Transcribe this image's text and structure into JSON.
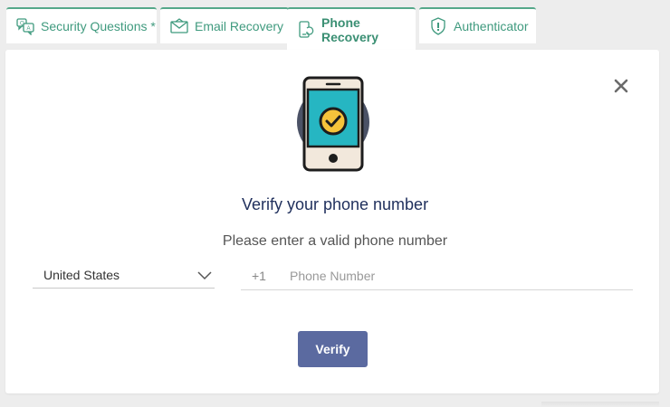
{
  "tabs": [
    {
      "label": "Security Questions *",
      "icon": "qa-chat-icon"
    },
    {
      "label": "Email Recovery",
      "icon": "envelope-icon"
    },
    {
      "label": "Phone Recovery",
      "icon": "phone-sync-icon",
      "active": true
    },
    {
      "label": "Authenticator",
      "icon": "shield-check-icon"
    }
  ],
  "dialog": {
    "title": "Verify your phone number",
    "subtitle": "Please enter a valid phone number",
    "close_icon": "close-icon",
    "illustration": "phone-check-icon"
  },
  "form": {
    "country": "United States",
    "dial_code": "+1",
    "phone_placeholder": "Phone Number",
    "phone_value": "",
    "verify_label": "Verify"
  },
  "colors": {
    "tab_accent": "#55a88a",
    "button": "#5b6aa0",
    "title": "#1f2f5c",
    "phone_screen": "#26b6c2",
    "check_circle": "#f5c33b"
  }
}
